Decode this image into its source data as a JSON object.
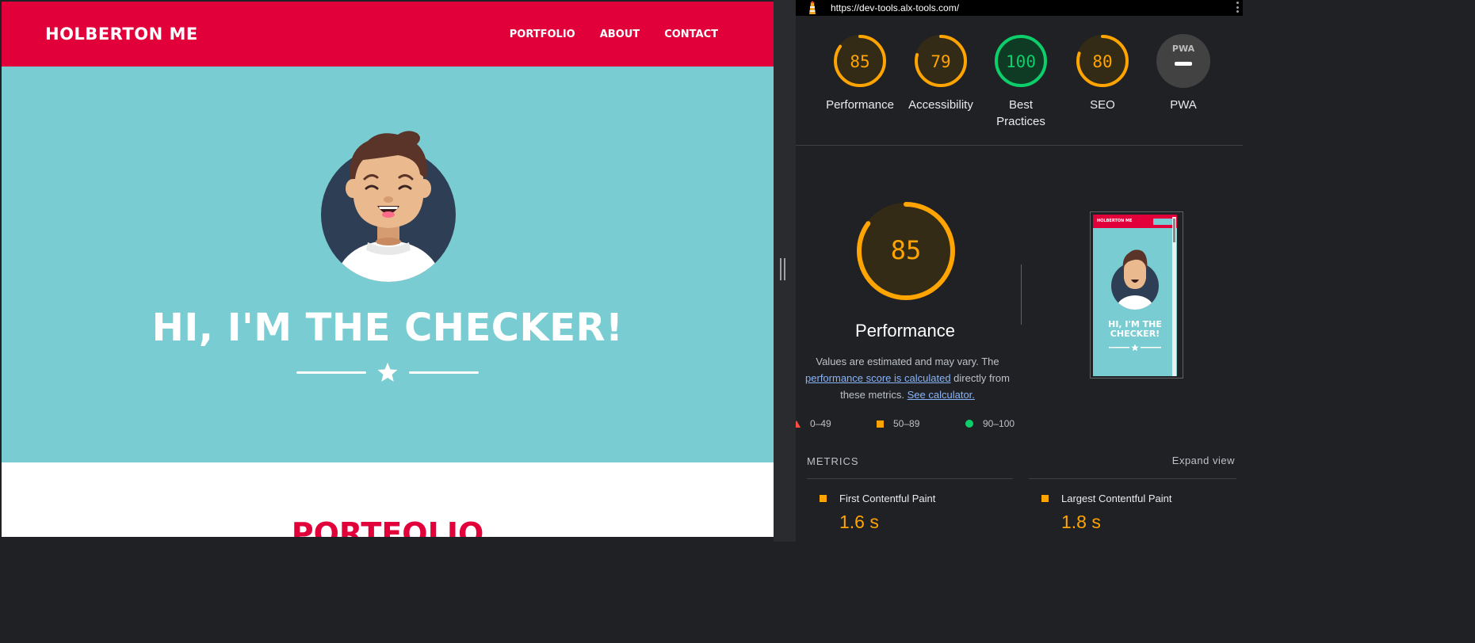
{
  "site": {
    "brand": "HOLBERTON ME",
    "nav": [
      "PORTFOLIO",
      "ABOUT",
      "CONTACT"
    ],
    "hero_title": "HI, I'M THE CHECKER!",
    "portfolio_title": "PORTFOLIO",
    "colors": {
      "primary": "#e2003b",
      "hero_bg": "#79cdd2"
    }
  },
  "devtools": {
    "url": "https://dev-tools.alx-tools.com/",
    "gauges": [
      {
        "score": "85",
        "label": "Performance",
        "fraction": 0.85,
        "status": "average"
      },
      {
        "score": "79",
        "label": "Accessibility",
        "fraction": 0.79,
        "status": "average"
      },
      {
        "score": "100",
        "label": "Best Practices",
        "fraction": 1.0,
        "status": "pass"
      },
      {
        "score": "80",
        "label": "SEO",
        "fraction": 0.8,
        "status": "average"
      },
      {
        "score": "PWA",
        "label": "PWA",
        "fraction": 0,
        "status": "na"
      }
    ],
    "performance": {
      "score": "85",
      "title": "Performance",
      "desc_pre": "Values are estimated and may vary. The ",
      "desc_link": "performance score is calculated",
      "desc_mid": " directly from these metrics. ",
      "desc_link2": "See calculator."
    },
    "thumbnail": {
      "brand": "HOLBERTON ME",
      "title": "HI, I'M THE CHECKER!"
    },
    "legend": [
      "0–49",
      "50–89",
      "90–100"
    ],
    "metrics_label": "METRICS",
    "expand_label": "Expand view",
    "metrics": [
      {
        "name": "First Contentful Paint",
        "value": "1.6 s"
      },
      {
        "name": "Largest Contentful Paint",
        "value": "1.8 s"
      }
    ],
    "colors": {
      "average": "#ffa400",
      "pass": "#0cce6b",
      "fail": "#ff4e42"
    }
  }
}
